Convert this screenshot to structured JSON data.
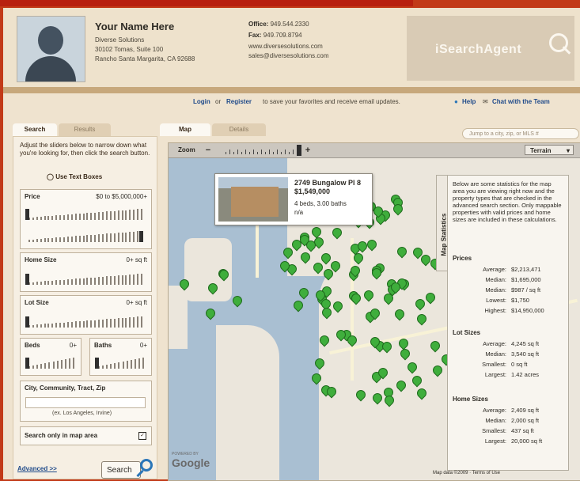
{
  "header": {
    "agent_name": "Your Name Here",
    "company": "Diverse Solutions",
    "address1": "30102 Tomas, Suite 100",
    "address2": "Rancho Santa Margarita, CA 92688",
    "office_label": "Office:",
    "office_phone": "949.544.2330",
    "fax_label": "Fax:",
    "fax_phone": "949.709.8794",
    "website": "www.diversesolutions.com",
    "email": "sales@diversesolutions.com",
    "logo_text": "iSearchAgent"
  },
  "loginbar": {
    "login": "Login",
    "or": "or",
    "register": "Register",
    "message": "to save your favorites and receive email updates.",
    "help": "Help",
    "chat": "Chat with the Team"
  },
  "left_tabs": {
    "search": "Search",
    "results": "Results"
  },
  "left": {
    "intro": "Adjust the sliders below to narrow down what you're looking for, then click the search button.",
    "use_text_boxes": "Use Text Boxes",
    "price": {
      "label": "Price",
      "value": "$0 to $5,000,000+"
    },
    "home_size": {
      "label": "Home Size",
      "value": "0+ sq ft"
    },
    "lot_size": {
      "label": "Lot Size",
      "value": "0+ sq ft"
    },
    "beds": {
      "label": "Beds",
      "value": "0+"
    },
    "baths": {
      "label": "Baths",
      "value": "0+"
    },
    "location": {
      "label": "City, Community, Tract, Zip",
      "hint": "(ex. Los Angeles, Irvine)"
    },
    "map_only": {
      "label": "Search only in map area",
      "checked": true
    },
    "advanced": "Advanced >>",
    "search_button": "Search"
  },
  "map_tabs": {
    "map": "Map",
    "details": "Details"
  },
  "map": {
    "jump_placeholder": "Jump to a city, zip, or MLS #",
    "zoom_label": "Zoom",
    "zoom_minus": "−",
    "zoom_plus": "+",
    "terrain": "Terrain",
    "popup": {
      "address": "2749 Bungalow Pl",
      "unit": "8",
      "price": "$1,549,000",
      "beds_baths": "4 beds, 3.00 baths",
      "extra": "n/a"
    },
    "stats_tab": "Map Statistics",
    "google": "Google",
    "powered": "POWERED BY",
    "footer": "Map data ©2009 · Terms of Use"
  },
  "stats": {
    "description": "Below are some statistics for the map area you are viewing right now and the property types that are checked in the advanced search section. Only mappable properties with valid prices and home sizes are included in these calculations.",
    "prices_title": "Prices",
    "prices": [
      {
        "k": "Average:",
        "v": "$2,213,471"
      },
      {
        "k": "Median:",
        "v": "$1,695,000"
      },
      {
        "k": "Median:",
        "v": "$987 / sq ft"
      },
      {
        "k": "Lowest:",
        "v": "$1,750"
      },
      {
        "k": "Highest:",
        "v": "$14,950,000"
      }
    ],
    "lot_title": "Lot Sizes",
    "lot": [
      {
        "k": "Average:",
        "v": "4,245 sq ft"
      },
      {
        "k": "Median:",
        "v": "3,540 sq ft"
      },
      {
        "k": "Smallest:",
        "v": "0 sq ft"
      },
      {
        "k": "Largest:",
        "v": "1.42 acres"
      }
    ],
    "home_title": "Home Sizes",
    "home": [
      {
        "k": "Average:",
        "v": "2,409 sq ft"
      },
      {
        "k": "Median:",
        "v": "2,000 sq ft"
      },
      {
        "k": "Smallest:",
        "v": "437 sq ft"
      },
      {
        "k": "Largest:",
        "v": "20,000 sq ft"
      }
    ]
  }
}
